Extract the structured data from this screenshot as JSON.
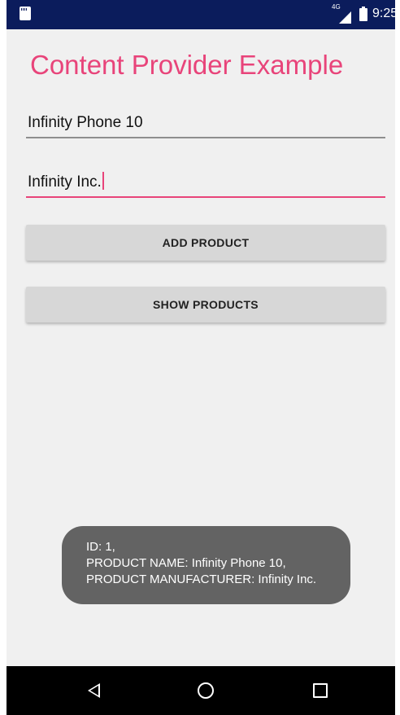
{
  "status_bar": {
    "network_type": "4G",
    "time": "9:25",
    "icons": [
      "sd-card-icon",
      "signal-icon",
      "battery-charging-icon"
    ],
    "background_color": "#0b1c5c"
  },
  "app": {
    "title": "Content Provider Example",
    "accent_color": "#e8447a",
    "fields": {
      "product_name": "Infinity Phone 10",
      "manufacturer": "Infinity Inc."
    },
    "buttons": {
      "add_product": "ADD PRODUCT",
      "show_products": "SHOW PRODUCTS"
    }
  },
  "toast": {
    "line1": "ID: 1,",
    "line2": "PRODUCT NAME: Infinity Phone 10,",
    "line3": "PRODUCT MANUFACTURER: Infinity Inc."
  },
  "nav_bar": {
    "icons": [
      "back-icon",
      "home-icon",
      "recent-apps-icon"
    ]
  }
}
